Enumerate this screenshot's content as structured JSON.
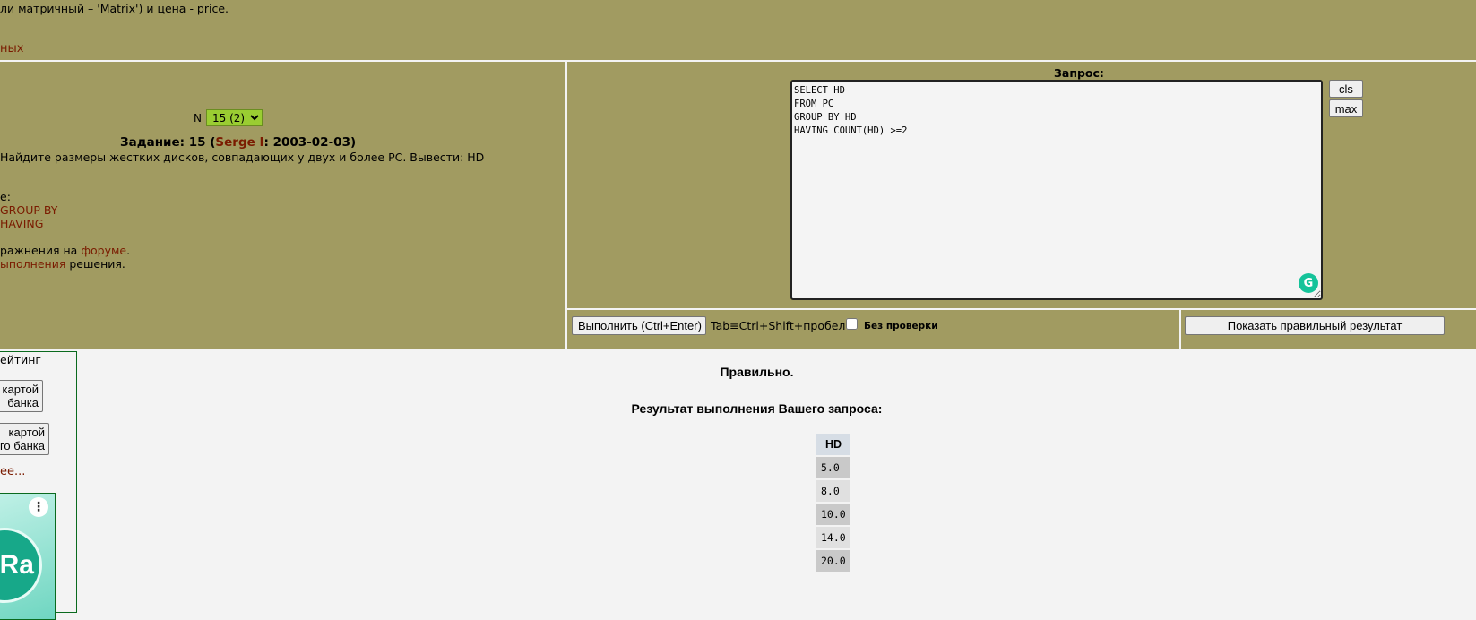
{
  "top": {
    "description": "ли матричный – 'Matrix') и цена - price.",
    "more_link": "ных"
  },
  "task": {
    "n_label": "N",
    "selected_option": "15 (2)",
    "title_prefix": "Задание: 15 (",
    "author": "Serge I",
    "title_suffix": ": 2003-02-03)",
    "text": "Найдите размеры жестких дисков, совпадающих у двух и более PC. Вывести: HD",
    "line_colon": "е:",
    "link_group_by": "GROUP BY",
    "link_having": "HAVING",
    "forum_prefix": "ражнения на ",
    "forum_link": "форуме",
    "forum_suffix": ".",
    "exec_link": "ыполнения",
    "exec_suffix": " решения."
  },
  "query": {
    "label": "Запрос:",
    "sql": "SELECT HD\nFROM PC\nGROUP BY HD\nHAVING COUNT(HD) >=2",
    "cls_label": "cls",
    "max_label": "max",
    "grammarly_icon": "G"
  },
  "actions": {
    "run_label": "Выполнить (Ctrl+Enter)",
    "tab_hint": "Tab≡Ctrl+Shift+пробел",
    "no_check_label": "Без  проверки",
    "show_result_label": "Показать правильный результат"
  },
  "sidebar": {
    "rating": "ейтинг",
    "card_button_1": "картой\n банка",
    "card_button_2": "картой\nго банка",
    "more": "ее...",
    "ad_logo": "Ra",
    "ad_menu_icon": "⋮"
  },
  "results": {
    "status": "Правильно.",
    "heading": "Результат выполнения Вашего запроса:",
    "column": "HD",
    "rows": [
      "5.0",
      "8.0",
      "10.0",
      "14.0",
      "20.0"
    ]
  },
  "colors": {
    "panel_olive": "#a19b61",
    "link_brown": "#7a1b00",
    "select_green": "#9acd32",
    "grammarly_green": "#15c39a"
  }
}
